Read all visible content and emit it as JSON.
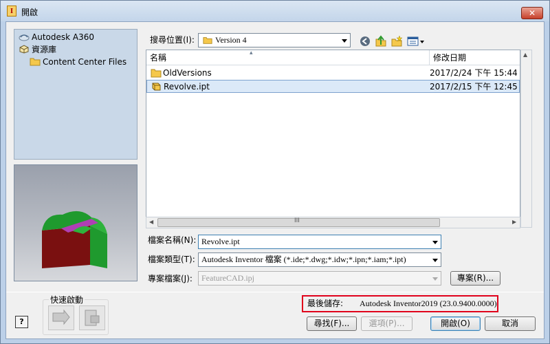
{
  "window": {
    "title": "開啟",
    "close_label": "✕"
  },
  "places": [
    {
      "label": "Autodesk A360",
      "icon": "cloud-icon"
    },
    {
      "label": "資源庫",
      "icon": "library-icon"
    },
    {
      "label": "Content Center Files",
      "icon": "folder-icon"
    }
  ],
  "lookin": {
    "label": "搜尋位置(I):",
    "value": "Version 4"
  },
  "toolbar_icons": [
    "back-icon",
    "up-folder-icon",
    "new-folder-icon",
    "view-menu-icon"
  ],
  "filelist": {
    "columns": {
      "name": "名稱",
      "date": "修改日期"
    },
    "rows": [
      {
        "name": "OldVersions",
        "date": "2017/2/24 下午 15:44",
        "icon": "folder-icon"
      },
      {
        "name": "Revolve.ipt",
        "date": "2017/2/15 下午 12:45",
        "icon": "part-file-icon",
        "selected": true
      }
    ],
    "scroll_grip": "III"
  },
  "fields": {
    "filename": {
      "label": "檔案名稱(N):",
      "value": "Revolve.ipt"
    },
    "filetype": {
      "label": "檔案類型(T):",
      "value": "Autodesk Inventor 檔案 (*.ide;*.dwg;*.idw;*.ipn;*.iam;*.ipt)"
    },
    "project": {
      "label": "專案檔案(J):",
      "value": "FeatureCAD.ipj",
      "button": "專案(R)..."
    }
  },
  "quick_launch": {
    "title": "快速啟動"
  },
  "help_label": "?",
  "last_saved": {
    "label": "最後儲存:",
    "value": "Autodesk Inventor2019 (23.0.9400.0000)"
  },
  "buttons": {
    "find": "尋找(F)...",
    "options": "選項(P)...",
    "open": "開啟(O)",
    "cancel": "取消"
  },
  "colors": {
    "titlebar": "#c3d5ea",
    "selection": "#dbe9f8",
    "highlight_box": "#e0001b",
    "part_green": "#1f9a2e",
    "part_red": "#7a1010",
    "part_magenta": "#b03fb4"
  }
}
